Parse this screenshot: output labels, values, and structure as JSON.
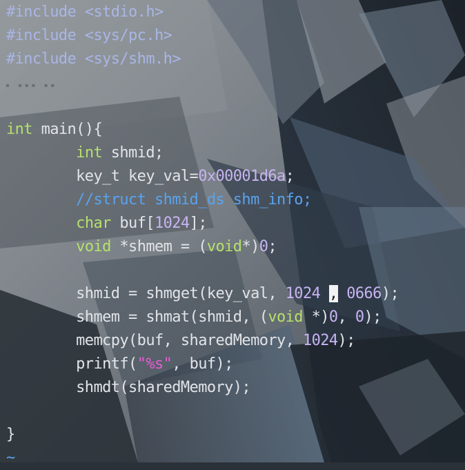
{
  "colors": {
    "background": "#2b3138",
    "preprocessor": "#a9b6e6",
    "keyword": "#b6e06d",
    "number": "#c8b4f2",
    "string": "#e85cd6",
    "comment": "#5aa3ee",
    "text": "#e2e4e8",
    "cursor": "#f2f2f2"
  },
  "editor": {
    "lines": [
      [
        {
          "t": "#include ",
          "c": "pp"
        },
        {
          "t": "<stdio.h>",
          "c": "pp"
        }
      ],
      [
        {
          "t": "#include ",
          "c": "pp"
        },
        {
          "t": "<sys/pc.h>",
          "c": "pp"
        }
      ],
      [
        {
          "t": "#include ",
          "c": "pp"
        },
        {
          "t": "<sys/shm.h>",
          "c": "pp"
        }
      ],
      [],
      [],
      [
        {
          "t": "int",
          "c": "kw"
        },
        {
          "t": " main(){",
          "c": "txt"
        }
      ],
      [
        {
          "t": "        ",
          "c": "txt"
        },
        {
          "t": "int",
          "c": "kw"
        },
        {
          "t": " shmid;",
          "c": "txt"
        }
      ],
      [
        {
          "t": "        key_t key_val=",
          "c": "txt"
        },
        {
          "t": "0x00001d6a",
          "c": "num"
        },
        {
          "t": ";",
          "c": "txt"
        }
      ],
      [
        {
          "t": "        ",
          "c": "txt"
        },
        {
          "t": "//struct shmid_ds shm_info;",
          "c": "cmt"
        }
      ],
      [
        {
          "t": "        ",
          "c": "txt"
        },
        {
          "t": "char",
          "c": "kw"
        },
        {
          "t": " buf[",
          "c": "txt"
        },
        {
          "t": "1024",
          "c": "num"
        },
        {
          "t": "];",
          "c": "txt"
        }
      ],
      [
        {
          "t": "        ",
          "c": "txt"
        },
        {
          "t": "void",
          "c": "kw"
        },
        {
          "t": " *shmem = (",
          "c": "txt"
        },
        {
          "t": "void",
          "c": "kw"
        },
        {
          "t": "*)",
          "c": "txt"
        },
        {
          "t": "0",
          "c": "num"
        },
        {
          "t": ";",
          "c": "txt"
        }
      ],
      [],
      [
        {
          "t": "        shmid = shmget(key_val, ",
          "c": "txt"
        },
        {
          "t": "1024",
          "c": "num"
        },
        {
          "t": " ",
          "c": "txt"
        },
        {
          "t": ",",
          "c": "cursor"
        },
        {
          "t": " ",
          "c": "txt"
        },
        {
          "t": "0666",
          "c": "num"
        },
        {
          "t": ");",
          "c": "txt"
        }
      ],
      [
        {
          "t": "        shmem = shmat(shmid, (",
          "c": "txt"
        },
        {
          "t": "void",
          "c": "kw"
        },
        {
          "t": " *)",
          "c": "txt"
        },
        {
          "t": "0",
          "c": "num"
        },
        {
          "t": ", ",
          "c": "txt"
        },
        {
          "t": "0",
          "c": "num"
        },
        {
          "t": ");",
          "c": "txt"
        }
      ],
      [
        {
          "t": "        memcpy(buf, sharedMemory, ",
          "c": "txt"
        },
        {
          "t": "1024",
          "c": "num"
        },
        {
          "t": ");",
          "c": "txt"
        }
      ],
      [
        {
          "t": "        printf(",
          "c": "txt"
        },
        {
          "t": "\"%s\"",
          "c": "str"
        },
        {
          "t": ", buf);",
          "c": "txt"
        }
      ],
      [
        {
          "t": "        shmdt(sharedMemory);",
          "c": "txt"
        }
      ],
      [],
      [
        {
          "t": "}",
          "c": "txt"
        }
      ],
      [
        {
          "t": "~",
          "c": "cmt"
        }
      ]
    ]
  }
}
